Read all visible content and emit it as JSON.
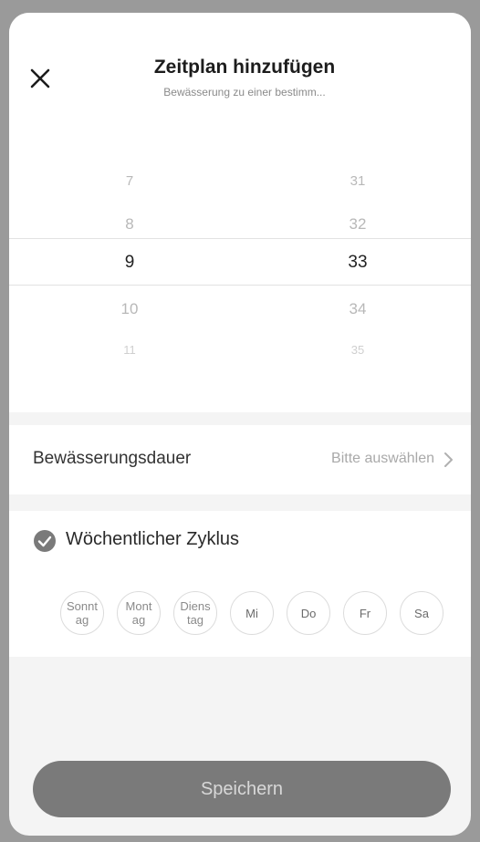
{
  "header": {
    "title": "Zeitplan hinzufügen",
    "subtitle": "Bewässerung zu einer bestimm..."
  },
  "picker": {
    "hours": [
      "7",
      "8",
      "9",
      "10",
      "11"
    ],
    "minutes": [
      "31",
      "32",
      "33",
      "34",
      "35"
    ],
    "selected_hour": "9",
    "selected_minute": "33"
  },
  "duration": {
    "label": "Bewässerungsdauer",
    "value": "Bitte auswählen"
  },
  "weekly": {
    "label": "Wöchentlicher Zyklus",
    "days": [
      "Sonntag",
      "Montag",
      "Dienstag",
      "Mi",
      "Do",
      "Fr",
      "Sa"
    ]
  },
  "save": {
    "label": "Speichern"
  },
  "icons": {
    "close": "close-icon",
    "chevron": "chevron-right-icon",
    "check": "check-circle-icon"
  }
}
